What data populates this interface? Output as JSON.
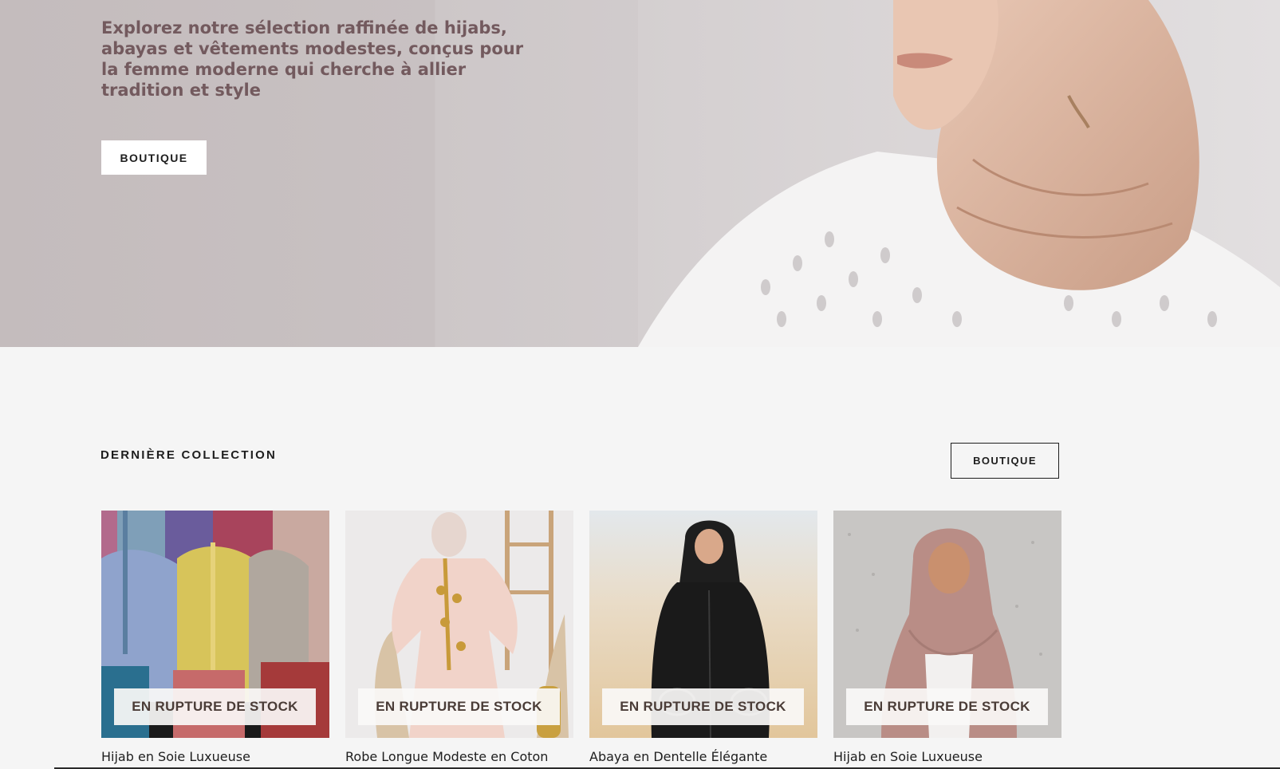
{
  "hero": {
    "tagline": "Explorez notre sélection raffinée de hijabs, abayas et vêtements modestes, conçus pour la femme moderne qui cherche à allier tradition et style",
    "button_label": "BOUTIQUE"
  },
  "collection": {
    "title": "DERNIÈRE COLLECTION",
    "button_label": "BOUTIQUE",
    "products": [
      {
        "name": "Hijab en Soie Luxueuse",
        "badge": "EN RUPTURE DE STOCK"
      },
      {
        "name": "Robe Longue Modeste en Coton",
        "badge": "EN RUPTURE DE STOCK"
      },
      {
        "name": "Abaya en Dentelle Élégante",
        "badge": "EN RUPTURE DE STOCK"
      },
      {
        "name": "Hijab en Soie Luxueuse",
        "badge": "EN RUPTURE DE STOCK"
      }
    ]
  },
  "colors": {
    "hero_text": "#735a5e",
    "page_background": "#f5f5f5",
    "badge_text": "#4a3c37"
  }
}
